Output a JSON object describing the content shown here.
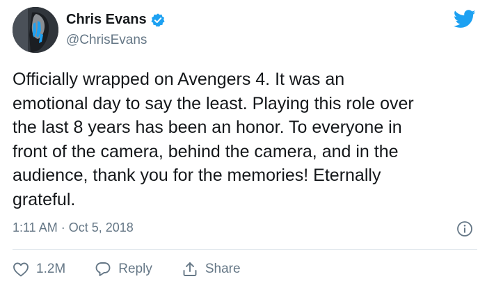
{
  "author": {
    "name": "Chris Evans",
    "handle": "@ChrisEvans",
    "verified": true
  },
  "tweet": {
    "lines": [
      "Officially wrapped on Avengers 4. It was an",
      "emotional day to say the least. Playing this role over",
      "the last 8 years has been an honor. To everyone in",
      "front of the camera, behind the camera, and in the",
      "audience, thank you for the memories! Eternally",
      "grateful."
    ],
    "timestamp": "1:11 AM · Oct 5, 2018"
  },
  "actions": {
    "like_count": "1.2M",
    "reply_label": "Reply",
    "share_label": "Share"
  },
  "icons": {
    "brand": "twitter-bird-icon",
    "verified": "verified-badge-icon",
    "info": "info-icon",
    "like": "heart-icon",
    "reply": "speech-bubble-icon",
    "share": "share-icon"
  },
  "colors": {
    "twitter_blue": "#1da1f2",
    "text_primary": "#14171a",
    "text_secondary": "#657786",
    "divider": "#e1e8ed"
  }
}
